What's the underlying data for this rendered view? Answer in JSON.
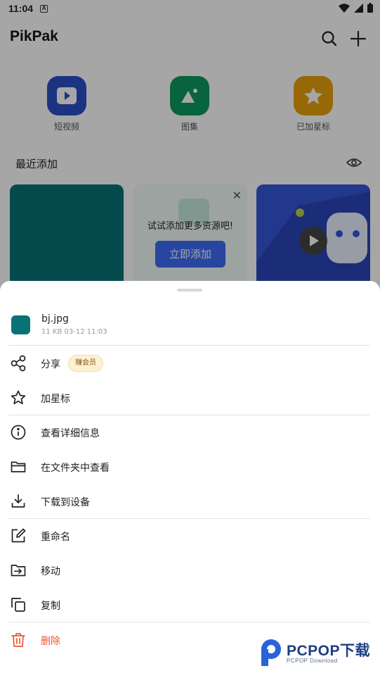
{
  "status_bar": {
    "time": "11:04",
    "notification_icon": "A"
  },
  "app": {
    "title": "PikPak"
  },
  "quick_access": [
    {
      "label": "短视频",
      "color": "#2b4fc7",
      "icon": "play-icon"
    },
    {
      "label": "图集",
      "color": "#0c9a5c",
      "icon": "image-icon"
    },
    {
      "label": "已加星标",
      "color": "#e8a20a",
      "icon": "star-icon"
    }
  ],
  "recent": {
    "title": "最近添加",
    "hint_card": {
      "text": "试试添加更多资源吧!",
      "button": "立即添加"
    }
  },
  "sheet": {
    "file": {
      "name": "bj.jpg",
      "meta": "11 KB 03-12 11:03"
    },
    "actions": [
      {
        "label": "分享",
        "icon": "share-icon",
        "badge": "赚会员"
      },
      {
        "label": "加星标",
        "icon": "star-outline-icon"
      },
      {
        "label": "查看详细信息",
        "icon": "info-icon"
      },
      {
        "label": "在文件夹中查看",
        "icon": "folder-icon"
      },
      {
        "label": "下载到设备",
        "icon": "download-icon"
      },
      {
        "label": "重命名",
        "icon": "rename-icon"
      },
      {
        "label": "移动",
        "icon": "move-icon"
      },
      {
        "label": "复制",
        "icon": "copy-icon"
      },
      {
        "label": "删除",
        "icon": "trash-icon"
      }
    ]
  },
  "watermark": {
    "text": "PCPOP下载",
    "sub": "PCPOP Download"
  },
  "colors": {
    "accent": "#3e6cf5",
    "danger": "#f0552d",
    "file_thumb": "#087377"
  }
}
